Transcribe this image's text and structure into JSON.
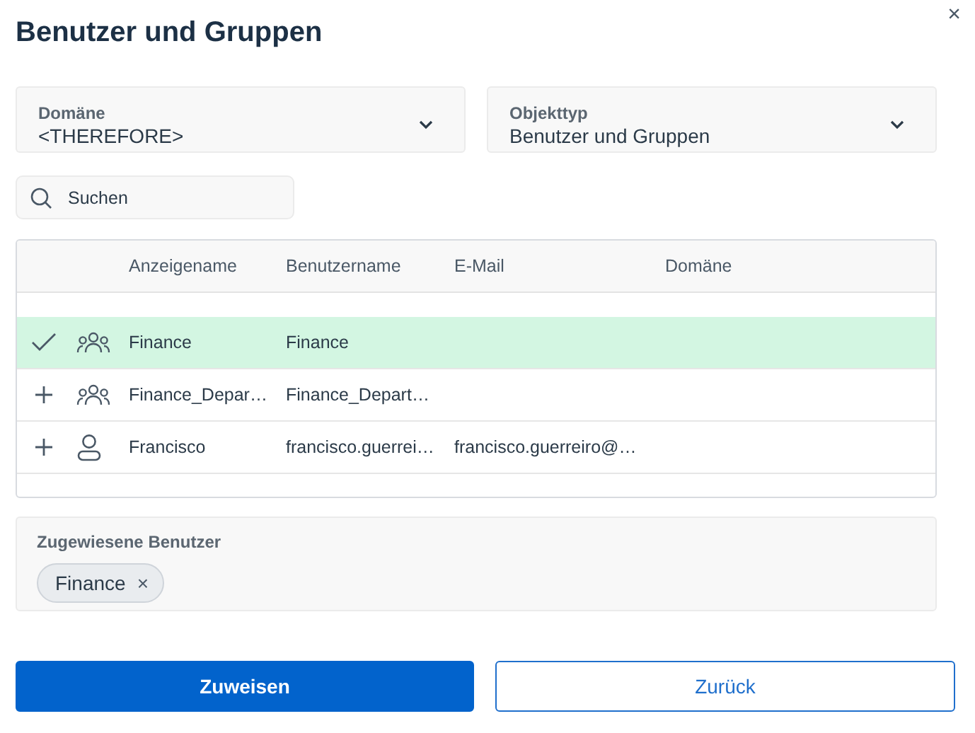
{
  "dialog": {
    "title": "Benutzer und Gruppen",
    "close": "×"
  },
  "filters": [
    {
      "label": "Domäne",
      "value": "<THEREFORE>"
    },
    {
      "label": "Objekttyp",
      "value": "Benutzer und Gruppen"
    }
  ],
  "search": {
    "placeholder": "Suchen"
  },
  "table": {
    "columns": [
      "Anzeigename",
      "Benutzername",
      "E-Mail",
      "Domäne"
    ],
    "rows": [
      {
        "kind": "group",
        "selected": true,
        "display_name": "Finance",
        "username": "Finance"
      },
      {
        "kind": "group",
        "selected": false,
        "display_name": "Finance_Depar…",
        "username": "Finance_Depart…"
      },
      {
        "kind": "user",
        "selected": false,
        "display_name": "Francisco",
        "username": "francisco.guerrei…",
        "email": "francisco.guerreiro@…"
      }
    ]
  },
  "assigned": {
    "label": "Zugewiesene Benutzer",
    "chips": [
      {
        "label": "Finance",
        "remove": "×"
      }
    ]
  },
  "buttons": [
    {
      "label": "Zuweisen",
      "kind": "primary"
    },
    {
      "label": "Zurück",
      "kind": "secondary"
    }
  ]
}
